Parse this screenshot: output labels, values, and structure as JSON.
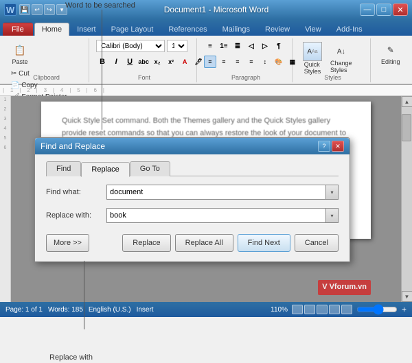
{
  "title_bar": {
    "icon": "W",
    "text": "Document1 - Microsoft Word",
    "min": "—",
    "max": "□",
    "close": "✕"
  },
  "ribbon_tabs": [
    "File",
    "Home",
    "Insert",
    "Page Layout",
    "References",
    "Mailings",
    "Review",
    "View",
    "Add-Ins"
  ],
  "ribbon": {
    "clipboard_label": "Clipboard",
    "font_label": "Font",
    "paragraph_label": "Paragraph",
    "styles_label": "Styles",
    "font_name": "Calibri (Body)",
    "font_size": "11",
    "format_buttons": [
      "B",
      "I",
      "U"
    ],
    "quick_styles_label": "Quick\nStyles",
    "change_styles_label": "Change\nStyles",
    "editing_label": "Editing"
  },
  "dialog": {
    "title": "Find and Replace",
    "help_btn": "?",
    "close_btn": "✕",
    "tabs": [
      "Find",
      "Replace",
      "Go To"
    ],
    "active_tab": "Replace",
    "find_label": "Find what:",
    "find_value": "document",
    "replace_label": "Replace with:",
    "replace_value": "book",
    "more_btn": "More >>",
    "replace_btn": "Replace",
    "replace_all_btn": "Replace All",
    "find_next_btn": "Find Next",
    "cancel_btn": "Cancel"
  },
  "doc_text": "Quick Style Set command. Both the Themes gallery and the Quick Styles gallery provide reset commands so that you can always restore the look of your document to the original contained in your current template.",
  "status_bar": {
    "page": "Page: 1 of 1",
    "words": "Words: 185",
    "language": "English (U.S.)",
    "mode": "Insert",
    "zoom": "110%"
  },
  "annotations": {
    "word_to_search": "Word to be searched",
    "replace_with": "Replace with"
  }
}
